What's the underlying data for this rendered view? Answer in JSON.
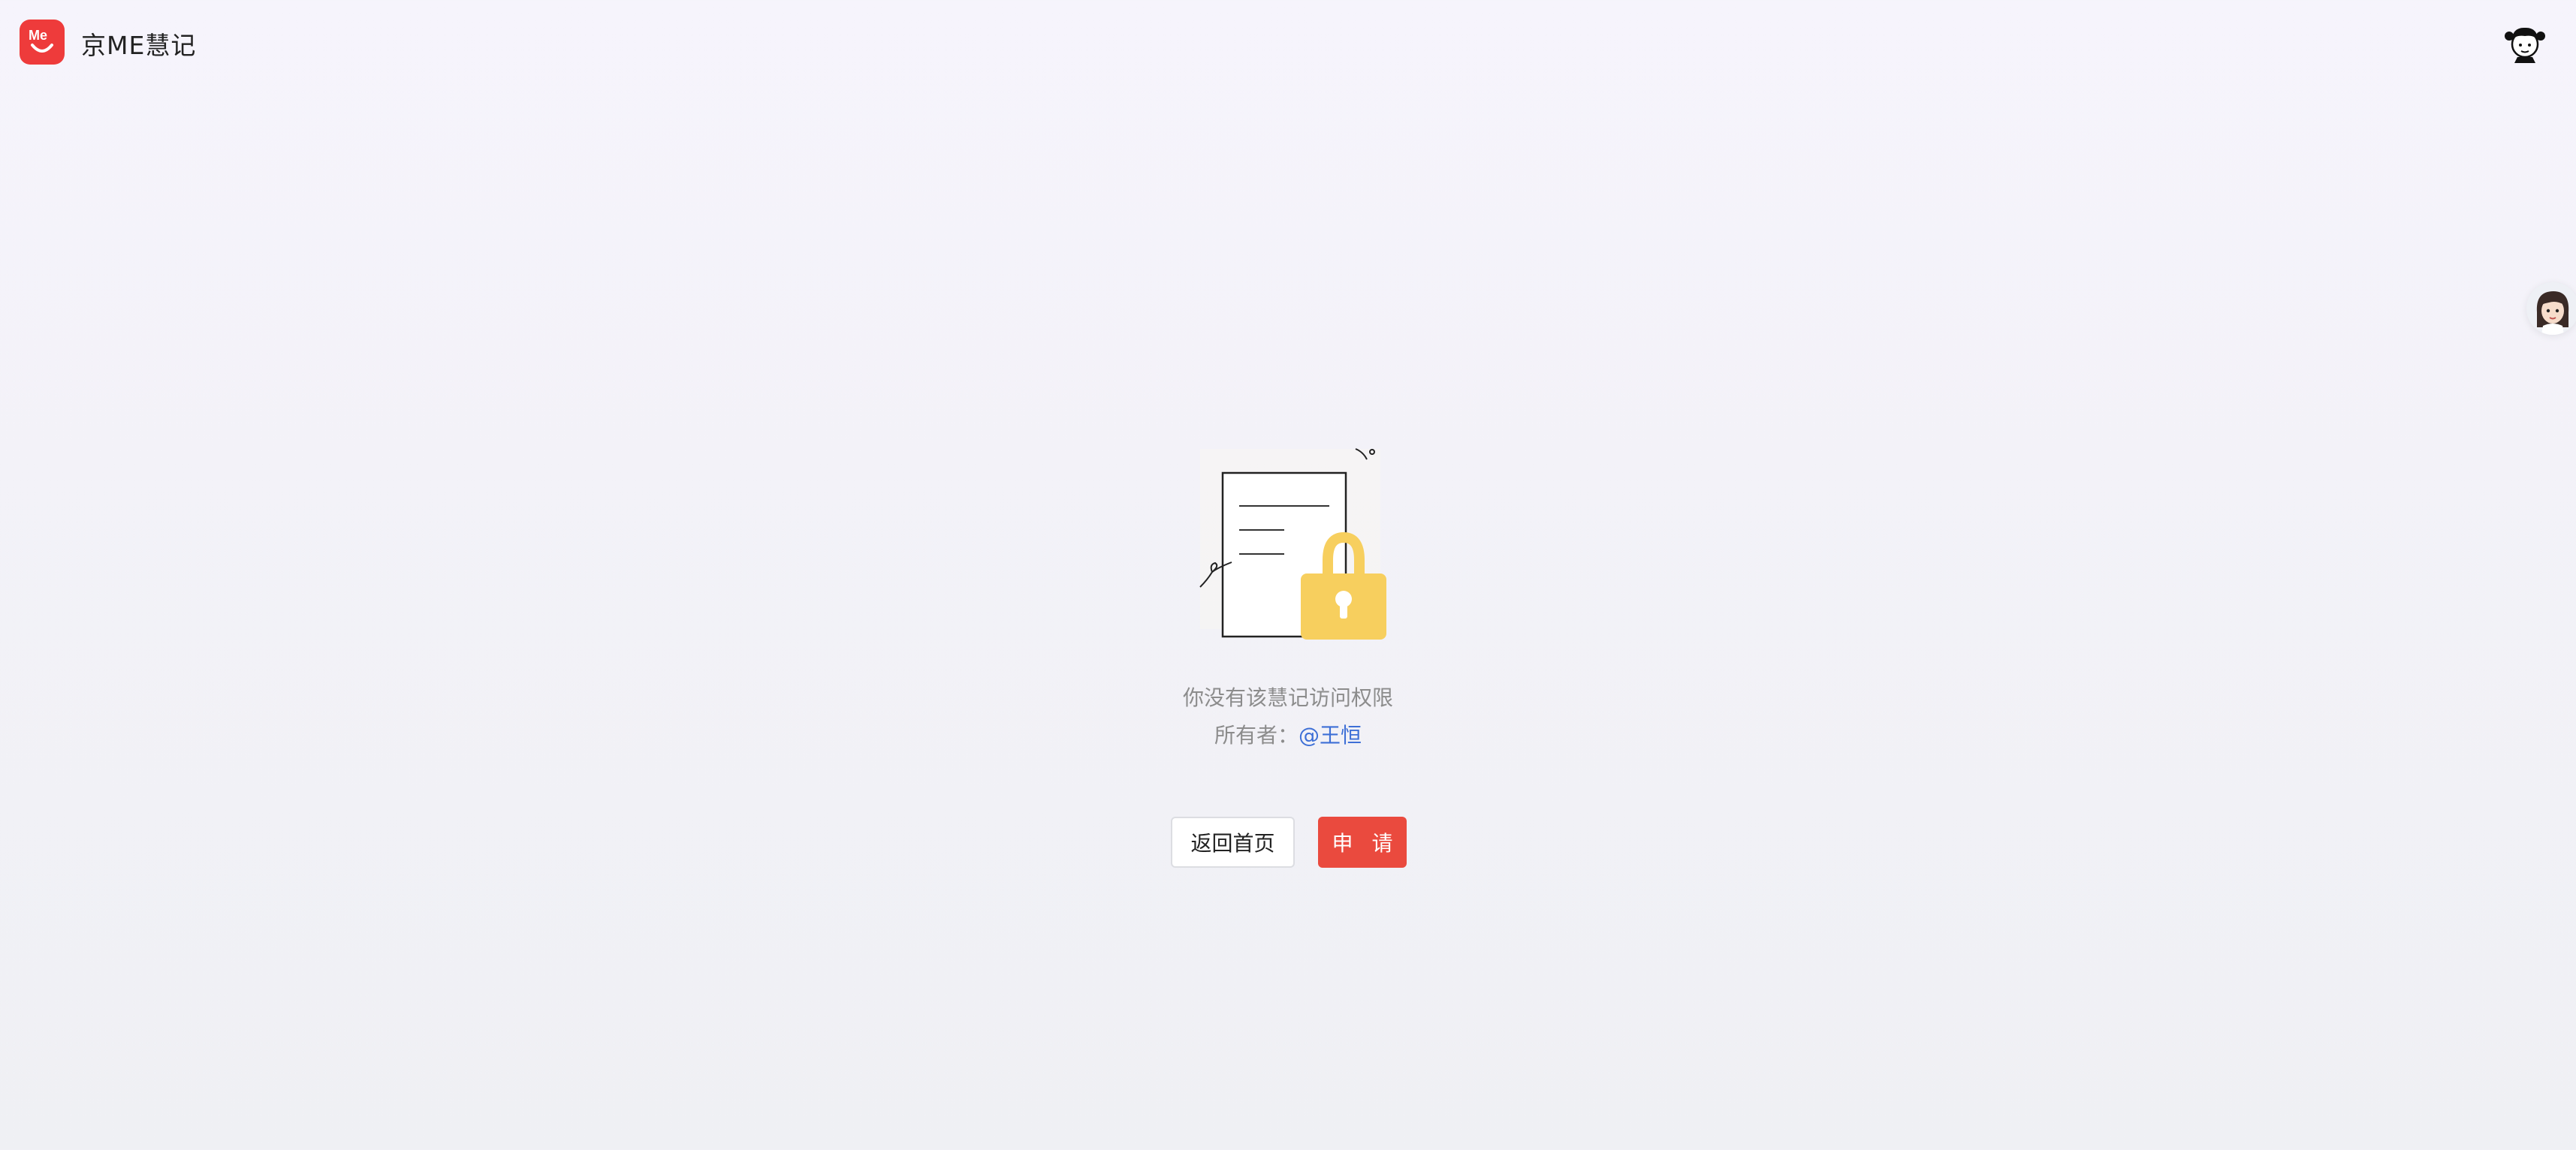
{
  "header": {
    "app_name": "京ME慧记",
    "logo_icon": "me-logo-icon",
    "user_avatar_icon": "user-avatar-icon"
  },
  "assistant": {
    "icon": "assistant-avatar-icon"
  },
  "main": {
    "illustration_icon": "locked-document-icon",
    "no_access_message": "你没有该慧记访问权限",
    "owner_label": "所有者：",
    "owner_name": "@王恒"
  },
  "actions": {
    "back_home_label": "返回首页",
    "apply_label": "申 请"
  },
  "colors": {
    "brand_red": "#ee3b3b",
    "apply_button": "#ea4a3e",
    "link_blue": "#3d6fd6",
    "lock_yellow": "#f7cf5e"
  }
}
